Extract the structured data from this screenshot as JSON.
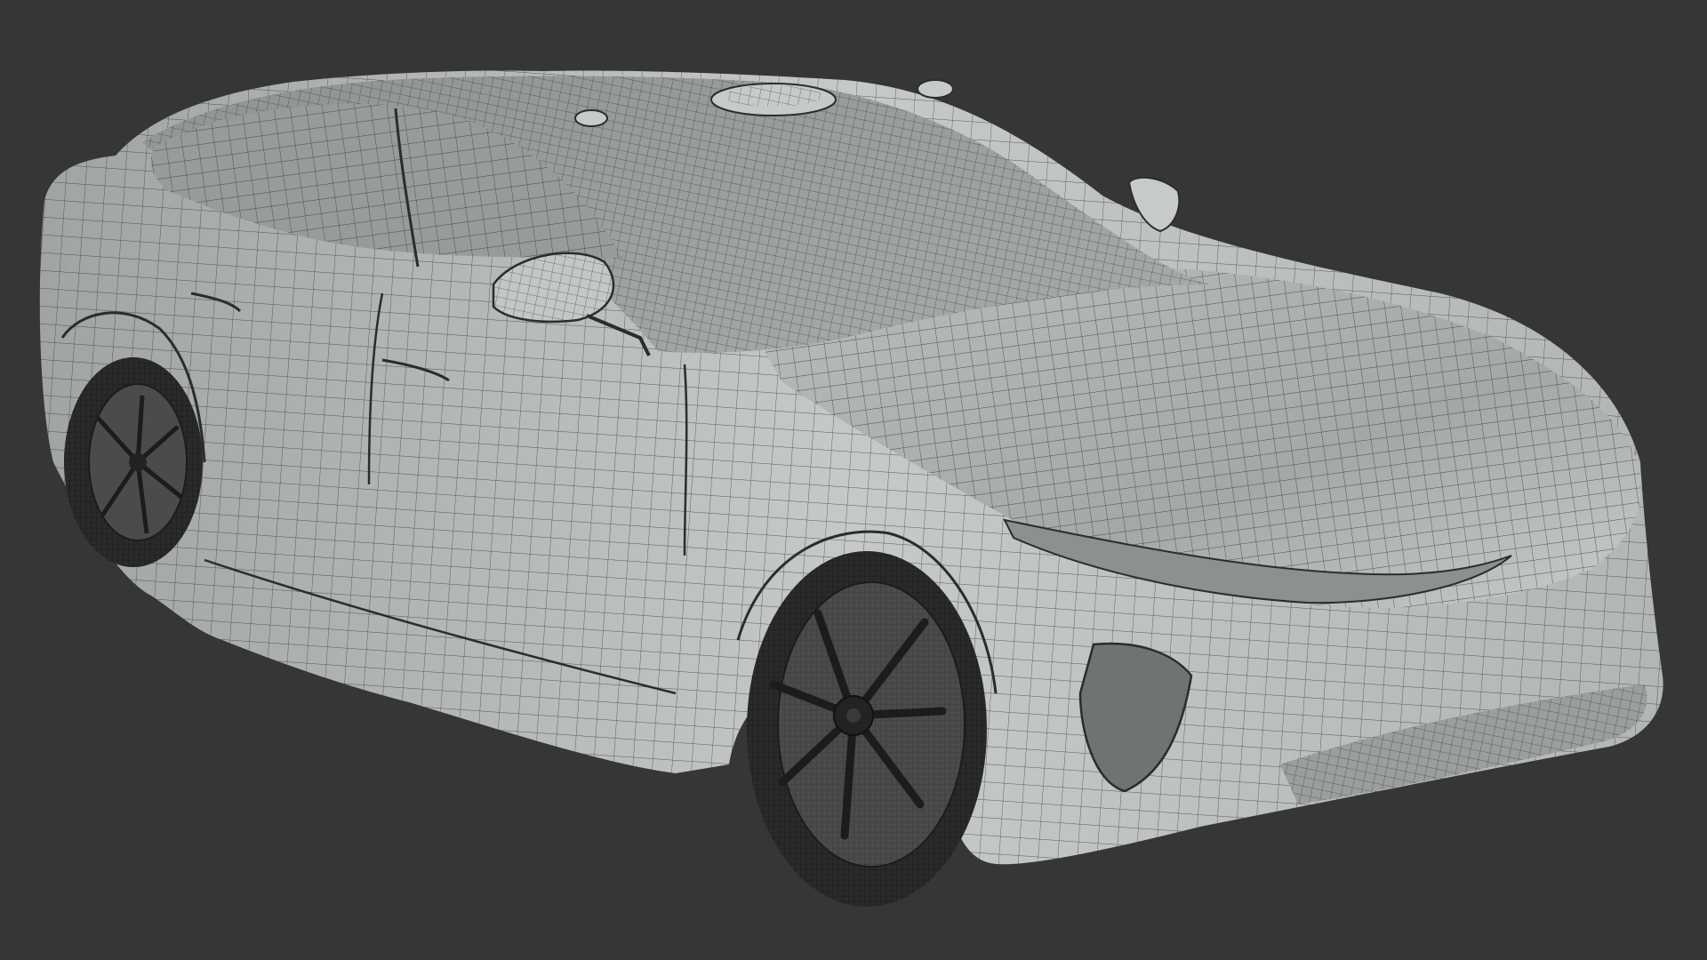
{
  "scene": {
    "background_color": "#363636",
    "subject": "car-wireframe-render",
    "colors": {
      "body_light": "#c9cdcc",
      "body_mid": "#a9adac",
      "body_dark": "#7d8180",
      "glass": "#9ea2a1",
      "wire": "#2b2d2d",
      "tire": "#2a2a2a",
      "rim": "#4a4c4c"
    }
  }
}
